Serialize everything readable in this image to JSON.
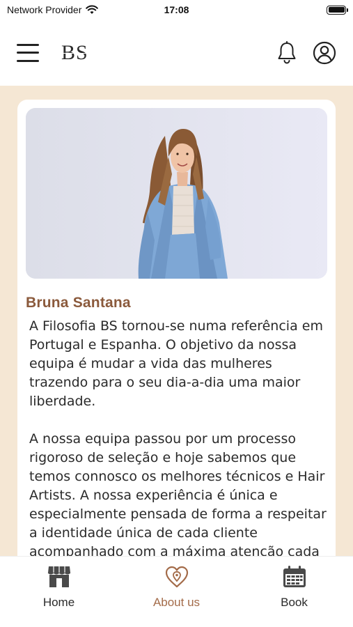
{
  "status_bar": {
    "carrier": "Network Provider",
    "time": "17:08",
    "battery_level": 1.0
  },
  "header": {
    "logo_text": "BS"
  },
  "profile": {
    "name": "Bruna Santana",
    "bio_paragraphs": [
      "A Filosofia BS tornou-se numa referência em Portugal e Espanha. O objetivo da nossa equipa é mudar a vida das mulheres trazendo para o seu dia-a-dia uma maior liberdade.",
      "A nossa equipa passou por um processo rigoroso de seleção e hoje sabemos que temos connosco os melhores técnicos e Hair Artists. A nossa experiência é única e especialmente pensada de forma a respeitar a identidade única de cada cliente acompanhado com a máxima atenção cada fase da sua vida."
    ]
  },
  "bottom_nav": {
    "items": [
      {
        "label": "Home",
        "icon": "store-icon",
        "active": false
      },
      {
        "label": "About us",
        "icon": "heart-location-icon",
        "active": true
      },
      {
        "label": "Book",
        "icon": "calendar-icon",
        "active": false
      }
    ]
  },
  "colors": {
    "accent": "#a36b49",
    "name": "#8b5a3c",
    "background": "#f5e7d4",
    "blazer": "#7fa8d6"
  }
}
